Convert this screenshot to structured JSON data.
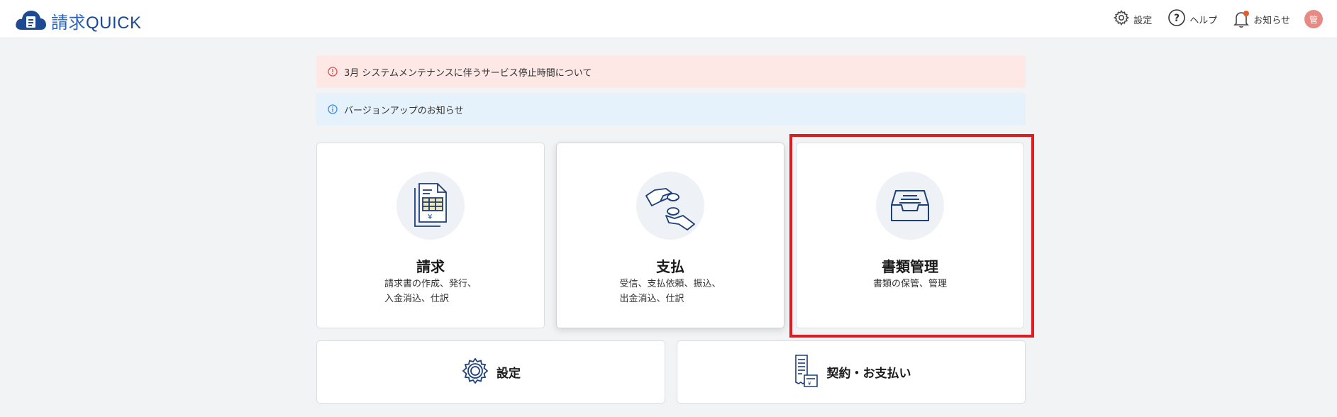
{
  "app": {
    "logo_kanji": "請求",
    "logo_latin": "QUICK"
  },
  "header": {
    "settings_label": "設定",
    "help_label": "ヘルプ",
    "notifications_label": "お知らせ",
    "avatar_initial": "管"
  },
  "notices": [
    {
      "text": "3月 システムメンテナンスに伴うサービス停止時間について",
      "level": "error",
      "color": "#fde8e6"
    },
    {
      "text": "バージョンアップのお知らせ",
      "level": "info",
      "color": "#e6f2fb"
    }
  ],
  "cards": [
    {
      "title": "請求",
      "desc_line1": "請求書の作成、発行、",
      "desc_line2": "入金消込、仕訳",
      "icon": "invoice-icon"
    },
    {
      "title": "支払",
      "desc_line1": "受信、支払依頼、振込、",
      "desc_line2": "出金消込、仕訳",
      "icon": "payment-hands-icon"
    },
    {
      "title": "書類管理",
      "desc_line1": "書類の保管、管理",
      "desc_line2": "",
      "icon": "document-tray-icon",
      "highlighted": true
    }
  ],
  "bottom_cards": [
    {
      "label": "設定",
      "icon": "gear-icon"
    },
    {
      "label": "契約・お支払い",
      "icon": "receipt-icon"
    }
  ],
  "colors": {
    "brand": "#1d4a93",
    "highlight": "#e01b22",
    "error_bg": "#fde8e6",
    "info_bg": "#e6f2fb"
  }
}
